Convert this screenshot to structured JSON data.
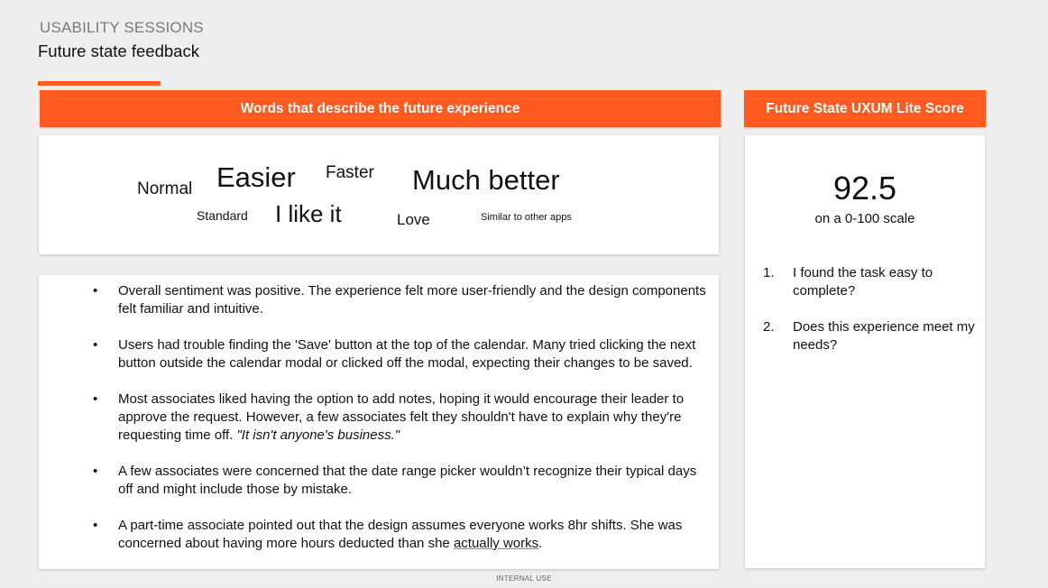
{
  "header": {
    "eyebrow": "USABILITY SESSIONS",
    "title": "Future state feedback"
  },
  "words_panel": {
    "banner": "Words that describe the future experience",
    "words": {
      "normal": "Normal",
      "easier": "Easier",
      "faster": "Faster",
      "much_better": "Much better",
      "standard": "Standard",
      "i_like_it": "I like it",
      "love": "Love",
      "similar": "Similar to other apps"
    }
  },
  "notes": {
    "items": [
      {
        "text": "Overall sentiment was positive. The experience felt more user-friendly and the design components felt familiar and intuitive."
      },
      {
        "text": "Users had trouble finding the 'Save' button at the top of the calendar. Many tried clicking the next button outside the calendar modal or clicked off the modal, expecting their changes to be saved."
      },
      {
        "text": "Most associates liked having the option to add notes, hoping it would encourage their leader to approve the request. However, a few associates felt they shouldn't have to explain why they're requesting time off. ",
        "quote": "\"It isn't anyone's business.\""
      },
      {
        "text": "A few associates were concerned that the date range picker wouldn’t recognize their typical days off and might include those by mistake."
      },
      {
        "text": "A part-time associate pointed out that the design assumes everyone works 8hr shifts. She was concerned about having more hours deducted than she ",
        "underlined": "actually works",
        "tail": "."
      }
    ]
  },
  "score_panel": {
    "banner": "Future State UXUM Lite Score",
    "score": "92.5",
    "caption": "on a 0-100 scale",
    "questions": [
      {
        "num": "1.",
        "text": " I found the task easy to complete?"
      },
      {
        "num": "2.",
        "text": "Does this experience meet my needs?"
      }
    ]
  },
  "footer": {
    "label": "INTERNAL USE"
  },
  "colors": {
    "accent": "#ff5a1f",
    "background": "#eeeeee",
    "card": "#ffffff"
  }
}
